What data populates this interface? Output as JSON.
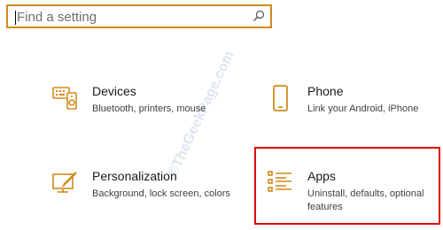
{
  "search": {
    "placeholder": "Find a setting"
  },
  "tiles": [
    {
      "title": "Devices",
      "description": "Bluetooth, printers, mouse",
      "icon": "keyboard-speaker-icon"
    },
    {
      "title": "Phone",
      "description": "Link your Android, iPhone",
      "icon": "phone-icon"
    },
    {
      "title": "Personalization",
      "description": "Background, lock screen, colors",
      "icon": "paintbrush-icon"
    },
    {
      "title": "Apps",
      "description": "Uninstall, defaults, optional features",
      "icon": "apps-list-icon"
    }
  ],
  "watermark": "©TheGeekPage.com",
  "colors": {
    "accent": "#d08a1c",
    "highlight": "#e00000"
  }
}
